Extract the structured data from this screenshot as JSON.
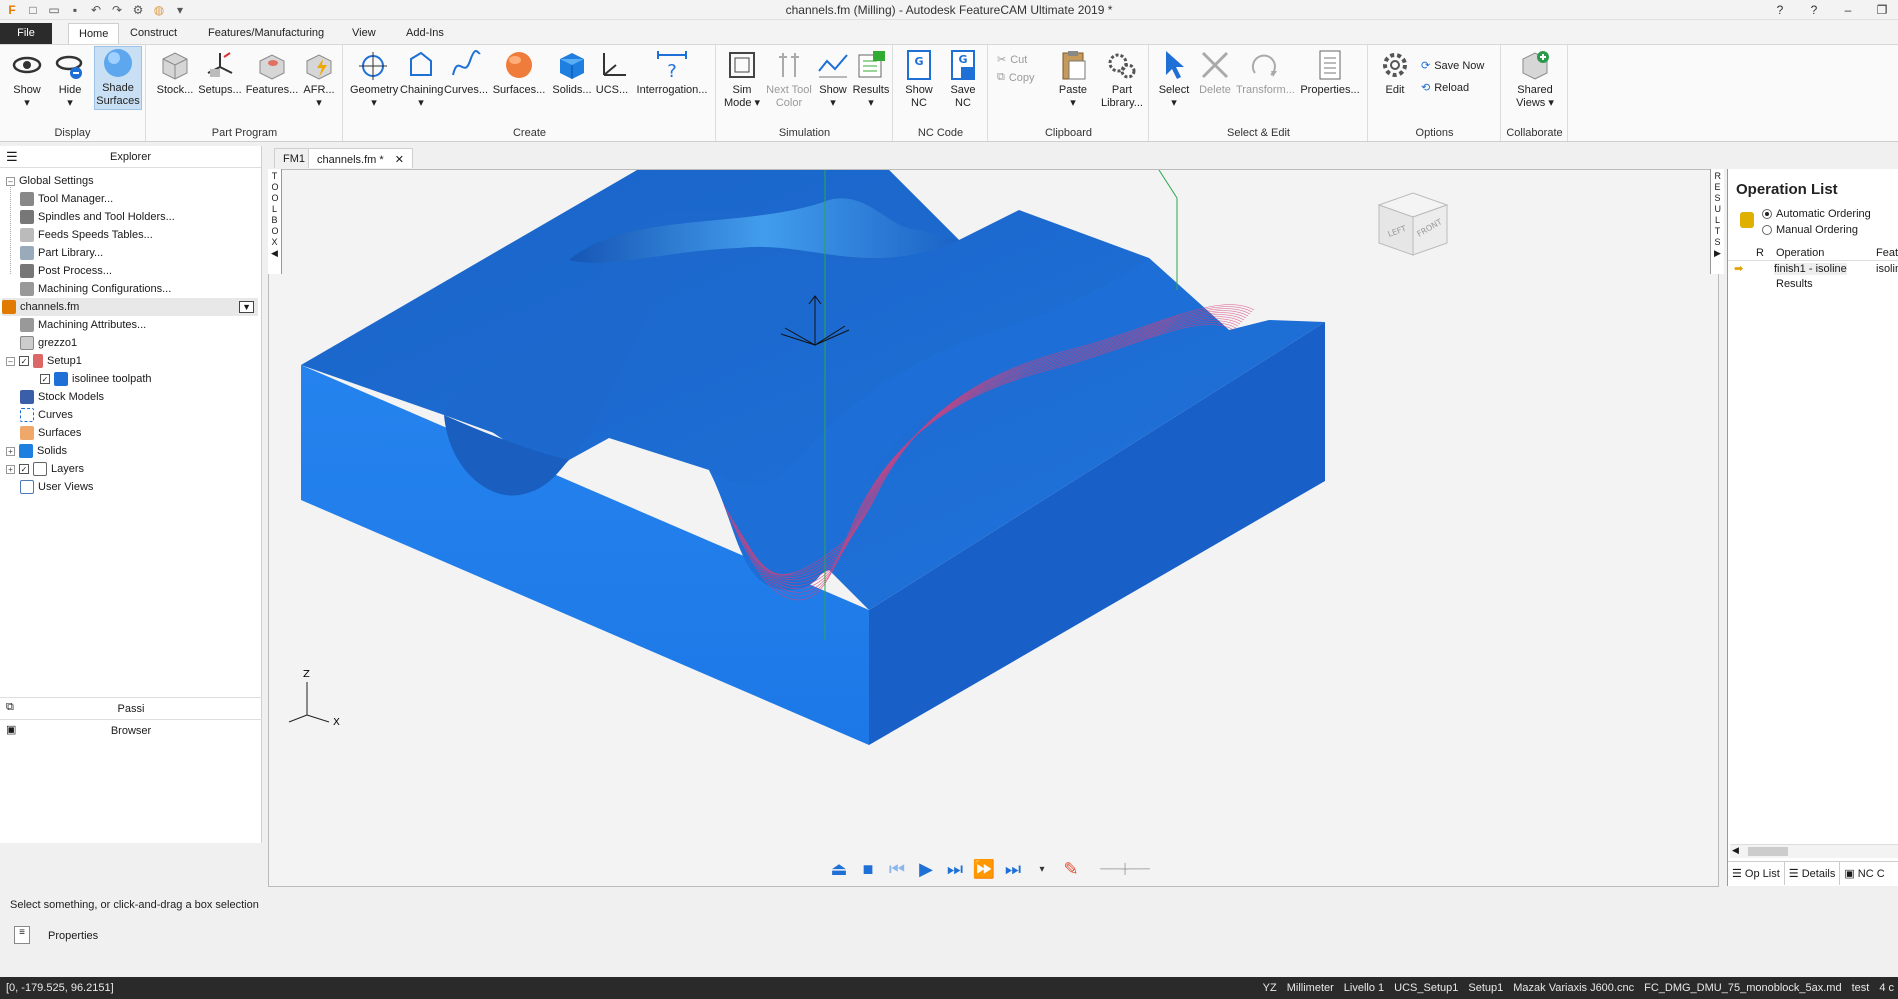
{
  "window": {
    "title": "channels.fm (Milling) - Autodesk FeatureCAM Ultimate 2019 *"
  },
  "ribbon_tabs": [
    "File",
    "Home",
    "Construct",
    "Features/Manufacturing",
    "View",
    "Add-Ins"
  ],
  "ribbon": {
    "display": {
      "label": "Display",
      "show": "Show",
      "hide": "Hide",
      "shade1": "Shade",
      "shade2": "Surfaces"
    },
    "part_program": {
      "label": "Part Program",
      "stock": "Stock...",
      "setups": "Setups...",
      "features": "Features...",
      "afr": "AFR..."
    },
    "create": {
      "label": "Create",
      "geometry": "Geometry",
      "chaining": "Chaining",
      "curves": "Curves...",
      "surfaces": "Surfaces...",
      "solids": "Solids...",
      "ucs": "UCS...",
      "interrogation": "Interrogation..."
    },
    "simulation": {
      "label": "Simulation",
      "sim1": "Sim",
      "sim2": "Mode",
      "next1": "Next Tool",
      "next2": "Color",
      "show": "Show",
      "results": "Results"
    },
    "nc_code": {
      "label": "NC Code",
      "show1": "Show",
      "show2": "NC",
      "save1": "Save",
      "save2": "NC"
    },
    "clipboard": {
      "label": "Clipboard",
      "cut": "Cut",
      "copy": "Copy",
      "paste": "Paste",
      "partlib1": "Part",
      "partlib2": "Library..."
    },
    "select_edit": {
      "label": "Select & Edit",
      "select": "Select",
      "delete": "Delete",
      "transform": "Transform...",
      "properties": "Properties..."
    },
    "options": {
      "label": "Options",
      "edit": "Edit",
      "save_now": "Save Now",
      "reload": "Reload"
    },
    "collaborate": {
      "label": "Collaborate",
      "shared1": "Shared",
      "shared2": "Views"
    }
  },
  "explorer": {
    "title": "Explorer",
    "global_settings": "Global Settings",
    "items_global": [
      "Tool Manager...",
      "Spindles and Tool Holders...",
      "Feeds  Speeds Tables...",
      "Part Library...",
      "Post Process...",
      "Machining Configurations..."
    ],
    "file": "channels.fm",
    "items_file": [
      "Machining Attributes...",
      "grezzo1",
      "Setup1",
      "isolinee toolpath",
      "Stock Models",
      "Curves",
      "Surfaces",
      "Solids",
      "Layers",
      "User Views"
    ]
  },
  "bottom_panels": {
    "passi": "Passi",
    "browser": "Browser"
  },
  "doc_tabs": [
    "FM1",
    "channels.fm *"
  ],
  "side_strips": {
    "toolbox": "TOOLBOX",
    "results": "RESULTS"
  },
  "viewcube": {
    "left": "LEFT",
    "front": "FRONT"
  },
  "axes": {
    "z": "Z",
    "x": "X"
  },
  "oplist": {
    "title": "Operation List",
    "auto": "Automatic Ordering",
    "manual": "Manual Ordering",
    "col_r": "R",
    "col_op": "Operation",
    "col_feat": "Feat",
    "row1": "finish1 - isoline",
    "row1_feat": "isolin",
    "results": "Results",
    "tabs": [
      "Op List",
      "Details",
      "NC C"
    ]
  },
  "status": {
    "prompt": "Select something, or click-and-drag a box selection",
    "properties": "Properties"
  },
  "bottombar": {
    "coords": "[0, -179.525, 96.2151]",
    "plane": "YZ",
    "units": "Millimeter",
    "layer": "Livello 1",
    "ucs": "UCS_Setup1",
    "setup": "Setup1",
    "post": "Mazak Variaxis J600.cnc",
    "md": "FC_DMG_DMU_75_monoblock_5ax.md",
    "test": "test",
    "count": "4 c"
  },
  "colors": {
    "model": "#1f78e0",
    "toolpath": "#d0306a",
    "accent": "#1e6fd6"
  }
}
